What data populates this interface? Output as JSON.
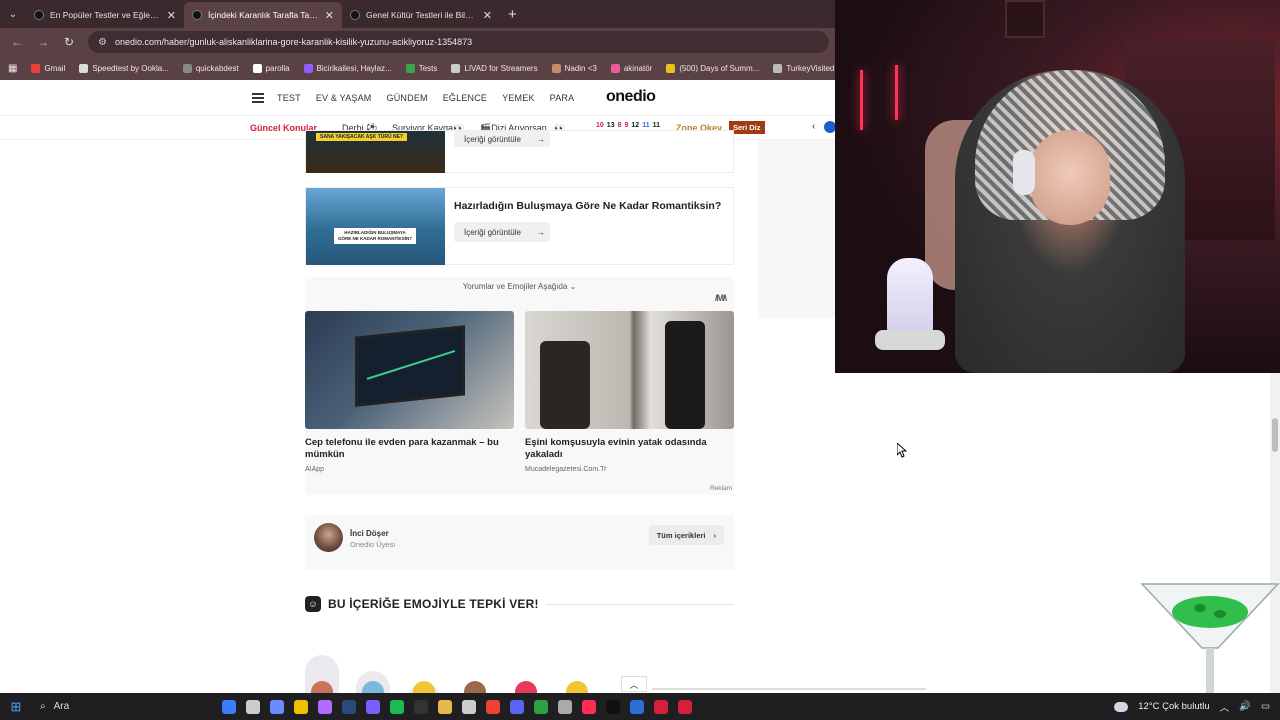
{
  "browser": {
    "tabs": [
      {
        "title": "En Popüler Testler ve Eğlenceli",
        "active": false
      },
      {
        "title": "İçindeki Karanlık Tarafla Tanışm",
        "active": true
      },
      {
        "title": "Genel Kültür Testleri ile Bilgini",
        "active": false
      }
    ],
    "new_tab_symbol": "+",
    "url": "onedio.com/haber/gunluk-aliskanliklarina-gore-karanlik-kisilik-yuzunu-acikliyoruz-1354873",
    "bookmarks": [
      {
        "label": "Gmail",
        "color": "#ea4335"
      },
      {
        "label": "Speedtest by Ookla...",
        "color": "#dddddd"
      },
      {
        "label": "quickabdest",
        "color": "#888888"
      },
      {
        "label": "parolla",
        "color": "#ffffff"
      },
      {
        "label": "Bicirikailesi, Haylaz...",
        "color": "#8f5cff"
      },
      {
        "label": "Tests",
        "color": "#3ca34c"
      },
      {
        "label": "LIVAD for Streamers",
        "color": "#cccccc"
      },
      {
        "label": "Nadin <3",
        "color": "#c98a6a"
      },
      {
        "label": "akinatör",
        "color": "#e85a9a"
      },
      {
        "label": "(500) Days of Summ...",
        "color": "#e8c21b"
      },
      {
        "label": "TurkeyVisited",
        "color": "#bbbbbb"
      }
    ]
  },
  "site": {
    "nav": [
      "TEST",
      "EV & YAŞAM",
      "GÜNDEM",
      "EĞLENCE",
      "YEMEK",
      "PARA"
    ],
    "logo": "onedio",
    "hot_title": "Güncel Konular",
    "hot_items": [
      "Derbi ⚽",
      "Survivor Kavga👀",
      "🎬Dizi Arıyorsan...👀"
    ],
    "scores": [
      {
        "n": "10",
        "color": "#d61f3c"
      },
      {
        "n": "13",
        "color": "#222222"
      },
      {
        "n": "8",
        "color": "#d61f3c"
      },
      {
        "n": "9",
        "color": "#d61f3c"
      },
      {
        "n": "12",
        "color": "#222222"
      },
      {
        "n": "11",
        "color": "#2f6fd6"
      },
      {
        "n": "11",
        "color": "#222222"
      }
    ],
    "zone": "Zone Okey",
    "seri": "Seri Diz"
  },
  "cards": [
    {
      "title": "",
      "banner": "SANA YAKIŞACAK AŞK TÜRÜ NE?",
      "button": "İçeriği görüntüle"
    },
    {
      "title": "Hazırladığın Buluşmaya Göre Ne Kadar Romantiksin?",
      "banner": "HAZIRLADIĞIN BULUŞMAYA GÖRE NE KADAR ROMANTİKSİN?",
      "button": "İçeriği görüntüle"
    }
  ],
  "ads": {
    "header": "Yorumlar ve Emojiler Aşağıda ⌄",
    "logo": "/M/\\",
    "items": [
      {
        "title": "Cep telefonu ile evden para kazanmak – bu mümkün",
        "source": "AIApp"
      },
      {
        "title": "Eşini komşusuyla evinin yatak odasında yakaladı",
        "source": "Mucadelegazetesi.Com.Tr"
      }
    ],
    "label": "Reklam"
  },
  "author": {
    "name": "İnci Döşer",
    "role": "Onedio Üyesi",
    "button": "Tüm içerikleri"
  },
  "reactions": {
    "title": "BU İÇERİĞE EMOJİYLE TEPKİ VER!",
    "bars": [
      {
        "level": 0.58,
        "face_color": "#c9745a"
      },
      {
        "level": 0.42,
        "face_color": "#7ab8e0"
      },
      {
        "level": 0.3,
        "face_color": "#f3c433"
      },
      {
        "level": 0.1,
        "face_color": "#9a6a4a"
      },
      {
        "level": 0.1,
        "face_color": "#e8385e"
      },
      {
        "level": 0.1,
        "face_color": "#f3c433"
      }
    ]
  },
  "taskbar": {
    "search": "Ara",
    "weather": "12°C  Çok bulutlu",
    "icon_colors": [
      "#3b7cff",
      "#cccccc",
      "#6a8cff",
      "#f0c000",
      "#b16cff",
      "#2a4a7a",
      "#7a5cff",
      "#1db954",
      "#333333",
      "#e8b84a",
      "#cccccc",
      "#ea4335",
      "#5865f2",
      "#2ea043",
      "#aaaaaa",
      "#ff2d55",
      "#111111",
      "#2a6fd6",
      "#d61f3c",
      "#d61f3c"
    ]
  }
}
